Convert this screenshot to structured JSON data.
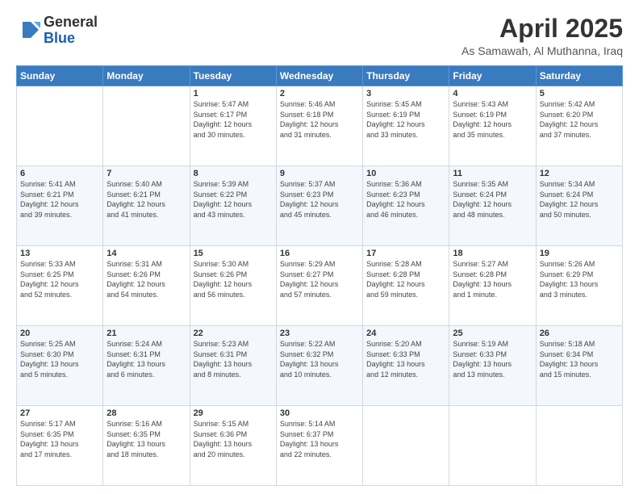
{
  "header": {
    "logo_general": "General",
    "logo_blue": "Blue",
    "title": "April 2025",
    "subtitle": "As Samawah, Al Muthanna, Iraq"
  },
  "weekdays": [
    "Sunday",
    "Monday",
    "Tuesday",
    "Wednesday",
    "Thursday",
    "Friday",
    "Saturday"
  ],
  "weeks": [
    [
      {
        "day": "",
        "info": ""
      },
      {
        "day": "",
        "info": ""
      },
      {
        "day": "1",
        "info": "Sunrise: 5:47 AM\nSunset: 6:17 PM\nDaylight: 12 hours\nand 30 minutes."
      },
      {
        "day": "2",
        "info": "Sunrise: 5:46 AM\nSunset: 6:18 PM\nDaylight: 12 hours\nand 31 minutes."
      },
      {
        "day": "3",
        "info": "Sunrise: 5:45 AM\nSunset: 6:19 PM\nDaylight: 12 hours\nand 33 minutes."
      },
      {
        "day": "4",
        "info": "Sunrise: 5:43 AM\nSunset: 6:19 PM\nDaylight: 12 hours\nand 35 minutes."
      },
      {
        "day": "5",
        "info": "Sunrise: 5:42 AM\nSunset: 6:20 PM\nDaylight: 12 hours\nand 37 minutes."
      }
    ],
    [
      {
        "day": "6",
        "info": "Sunrise: 5:41 AM\nSunset: 6:21 PM\nDaylight: 12 hours\nand 39 minutes."
      },
      {
        "day": "7",
        "info": "Sunrise: 5:40 AM\nSunset: 6:21 PM\nDaylight: 12 hours\nand 41 minutes."
      },
      {
        "day": "8",
        "info": "Sunrise: 5:39 AM\nSunset: 6:22 PM\nDaylight: 12 hours\nand 43 minutes."
      },
      {
        "day": "9",
        "info": "Sunrise: 5:37 AM\nSunset: 6:23 PM\nDaylight: 12 hours\nand 45 minutes."
      },
      {
        "day": "10",
        "info": "Sunrise: 5:36 AM\nSunset: 6:23 PM\nDaylight: 12 hours\nand 46 minutes."
      },
      {
        "day": "11",
        "info": "Sunrise: 5:35 AM\nSunset: 6:24 PM\nDaylight: 12 hours\nand 48 minutes."
      },
      {
        "day": "12",
        "info": "Sunrise: 5:34 AM\nSunset: 6:24 PM\nDaylight: 12 hours\nand 50 minutes."
      }
    ],
    [
      {
        "day": "13",
        "info": "Sunrise: 5:33 AM\nSunset: 6:25 PM\nDaylight: 12 hours\nand 52 minutes."
      },
      {
        "day": "14",
        "info": "Sunrise: 5:31 AM\nSunset: 6:26 PM\nDaylight: 12 hours\nand 54 minutes."
      },
      {
        "day": "15",
        "info": "Sunrise: 5:30 AM\nSunset: 6:26 PM\nDaylight: 12 hours\nand 56 minutes."
      },
      {
        "day": "16",
        "info": "Sunrise: 5:29 AM\nSunset: 6:27 PM\nDaylight: 12 hours\nand 57 minutes."
      },
      {
        "day": "17",
        "info": "Sunrise: 5:28 AM\nSunset: 6:28 PM\nDaylight: 12 hours\nand 59 minutes."
      },
      {
        "day": "18",
        "info": "Sunrise: 5:27 AM\nSunset: 6:28 PM\nDaylight: 13 hours\nand 1 minute."
      },
      {
        "day": "19",
        "info": "Sunrise: 5:26 AM\nSunset: 6:29 PM\nDaylight: 13 hours\nand 3 minutes."
      }
    ],
    [
      {
        "day": "20",
        "info": "Sunrise: 5:25 AM\nSunset: 6:30 PM\nDaylight: 13 hours\nand 5 minutes."
      },
      {
        "day": "21",
        "info": "Sunrise: 5:24 AM\nSunset: 6:31 PM\nDaylight: 13 hours\nand 6 minutes."
      },
      {
        "day": "22",
        "info": "Sunrise: 5:23 AM\nSunset: 6:31 PM\nDaylight: 13 hours\nand 8 minutes."
      },
      {
        "day": "23",
        "info": "Sunrise: 5:22 AM\nSunset: 6:32 PM\nDaylight: 13 hours\nand 10 minutes."
      },
      {
        "day": "24",
        "info": "Sunrise: 5:20 AM\nSunset: 6:33 PM\nDaylight: 13 hours\nand 12 minutes."
      },
      {
        "day": "25",
        "info": "Sunrise: 5:19 AM\nSunset: 6:33 PM\nDaylight: 13 hours\nand 13 minutes."
      },
      {
        "day": "26",
        "info": "Sunrise: 5:18 AM\nSunset: 6:34 PM\nDaylight: 13 hours\nand 15 minutes."
      }
    ],
    [
      {
        "day": "27",
        "info": "Sunrise: 5:17 AM\nSunset: 6:35 PM\nDaylight: 13 hours\nand 17 minutes."
      },
      {
        "day": "28",
        "info": "Sunrise: 5:16 AM\nSunset: 6:35 PM\nDaylight: 13 hours\nand 18 minutes."
      },
      {
        "day": "29",
        "info": "Sunrise: 5:15 AM\nSunset: 6:36 PM\nDaylight: 13 hours\nand 20 minutes."
      },
      {
        "day": "30",
        "info": "Sunrise: 5:14 AM\nSunset: 6:37 PM\nDaylight: 13 hours\nand 22 minutes."
      },
      {
        "day": "",
        "info": ""
      },
      {
        "day": "",
        "info": ""
      },
      {
        "day": "",
        "info": ""
      }
    ]
  ]
}
